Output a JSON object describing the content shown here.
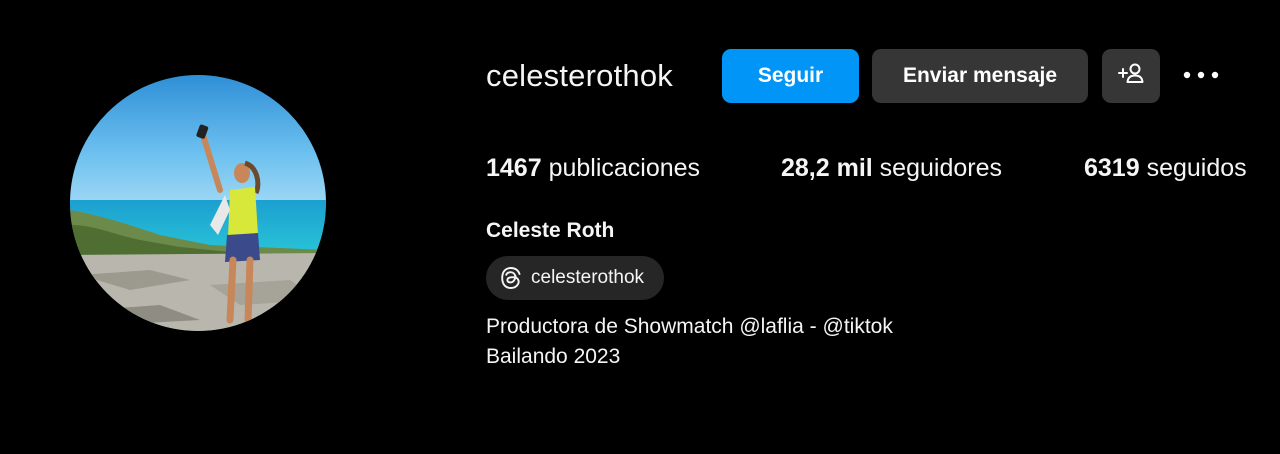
{
  "profile": {
    "username": "celesterothok",
    "full_name": "Celeste Roth",
    "avatar_icon": "profile-photo",
    "threads": {
      "icon": "threads-icon",
      "handle": "celesterothok"
    },
    "bio": {
      "line1_prefix": "Productora de Showmatch ",
      "mention1": "@laflia",
      "separator": " - ",
      "mention2": "@tiktok",
      "line2": "Bailando 2023"
    }
  },
  "actions": {
    "follow_label": "Seguir",
    "message_label": "Enviar mensaje",
    "suggest_icon": "add-person-icon",
    "more_icon": "more-options-icon"
  },
  "stats": {
    "posts_count": "1467",
    "posts_label": " publicaciones",
    "followers_count": "28,2 mil",
    "followers_label": " seguidores",
    "following_count": "6319",
    "following_label": " seguidos"
  },
  "colors": {
    "background": "#000000",
    "primary_button": "#0095f6",
    "secondary_button": "#363636",
    "chip": "#262626",
    "text": "#f5f5f5"
  }
}
